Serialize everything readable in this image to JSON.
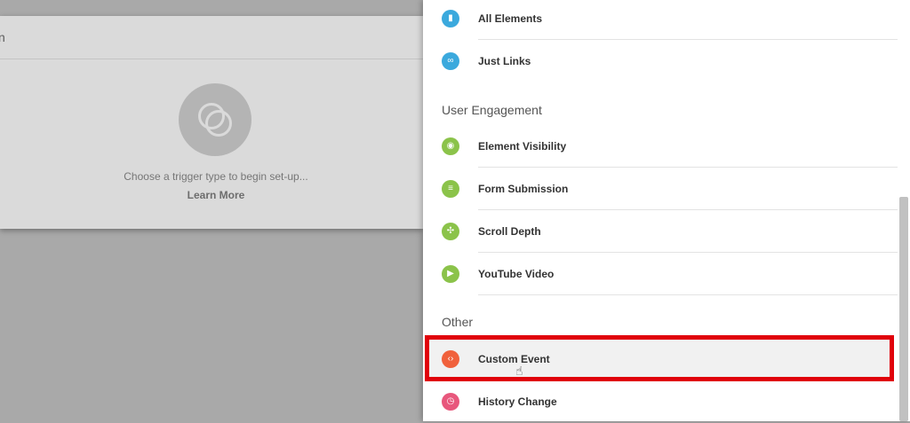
{
  "background": {
    "card_title": "n",
    "hint_text": "Choose a trigger type to begin set-up...",
    "learn_more": "Learn More"
  },
  "panel": {
    "items_top": [
      {
        "label": "All Elements",
        "icon": "cursor-icon",
        "color": "#3ba9dd"
      },
      {
        "label": "Just Links",
        "icon": "link-icon",
        "color": "#3ba9dd"
      }
    ],
    "sections": [
      {
        "title": "User Engagement"
      },
      {
        "title": "Other"
      }
    ],
    "engagement_items": [
      {
        "label": "Element Visibility",
        "icon": "eye-icon",
        "color": "#8bc34a"
      },
      {
        "label": "Form Submission",
        "icon": "form-icon",
        "color": "#8bc34a"
      },
      {
        "label": "Scroll Depth",
        "icon": "scroll-icon",
        "color": "#8bc34a"
      },
      {
        "label": "YouTube Video",
        "icon": "play-icon",
        "color": "#8bc34a"
      }
    ],
    "other_items": [
      {
        "label": "Custom Event",
        "icon": "code-icon",
        "color": "#f0613c",
        "highlighted": true
      },
      {
        "label": "History Change",
        "icon": "history-icon",
        "color": "#e8577c"
      }
    ]
  }
}
